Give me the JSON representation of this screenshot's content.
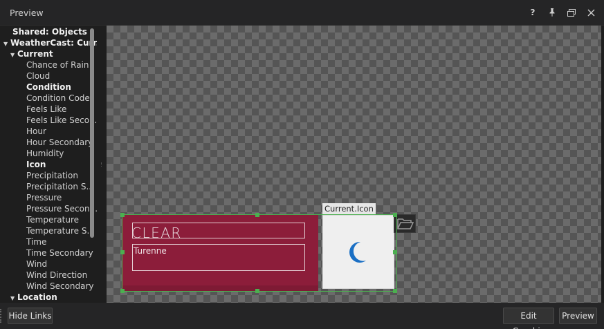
{
  "window": {
    "title": "Preview",
    "controls": {
      "help": "?"
    }
  },
  "tree": {
    "items": [
      {
        "label": "Shared: Objects",
        "bold": true
      },
      {
        "label": "WeatherCast: Curr...",
        "bold": true,
        "expanded": true
      },
      {
        "label": "Current",
        "bold": true,
        "expanded": true
      },
      {
        "label": "Chance of Rain"
      },
      {
        "label": "Cloud"
      },
      {
        "label": "Condition",
        "bold": true
      },
      {
        "label": "Condition Code"
      },
      {
        "label": "Feels Like"
      },
      {
        "label": "Feels Like Seco..."
      },
      {
        "label": "Hour"
      },
      {
        "label": "Hour Secondary"
      },
      {
        "label": "Humidity"
      },
      {
        "label": "Icon",
        "bold": true
      },
      {
        "label": "Precipitation"
      },
      {
        "label": "Precipitation S..."
      },
      {
        "label": "Pressure"
      },
      {
        "label": "Pressure Secon..."
      },
      {
        "label": "Temperature"
      },
      {
        "label": "Temperature S..."
      },
      {
        "label": "Time"
      },
      {
        "label": "Time Secondary"
      },
      {
        "label": "Wind"
      },
      {
        "label": "Wind Direction"
      },
      {
        "label": "Wind Secondary"
      },
      {
        "label": "Location",
        "bold": true,
        "expanded": true
      }
    ]
  },
  "graphic": {
    "condition_text": "CLEAR",
    "location_text": "Turenne",
    "icon_field_label": "Current.Icon",
    "icon": "crescent-moon-icon",
    "colors": {
      "panel": "#8c1d3a",
      "moon": "#1a6fc4",
      "selection": "#4caf50"
    }
  },
  "footer": {
    "hide_links": "Hide Links",
    "edit_graphic": "Edit Graphic",
    "preview": "Preview"
  }
}
